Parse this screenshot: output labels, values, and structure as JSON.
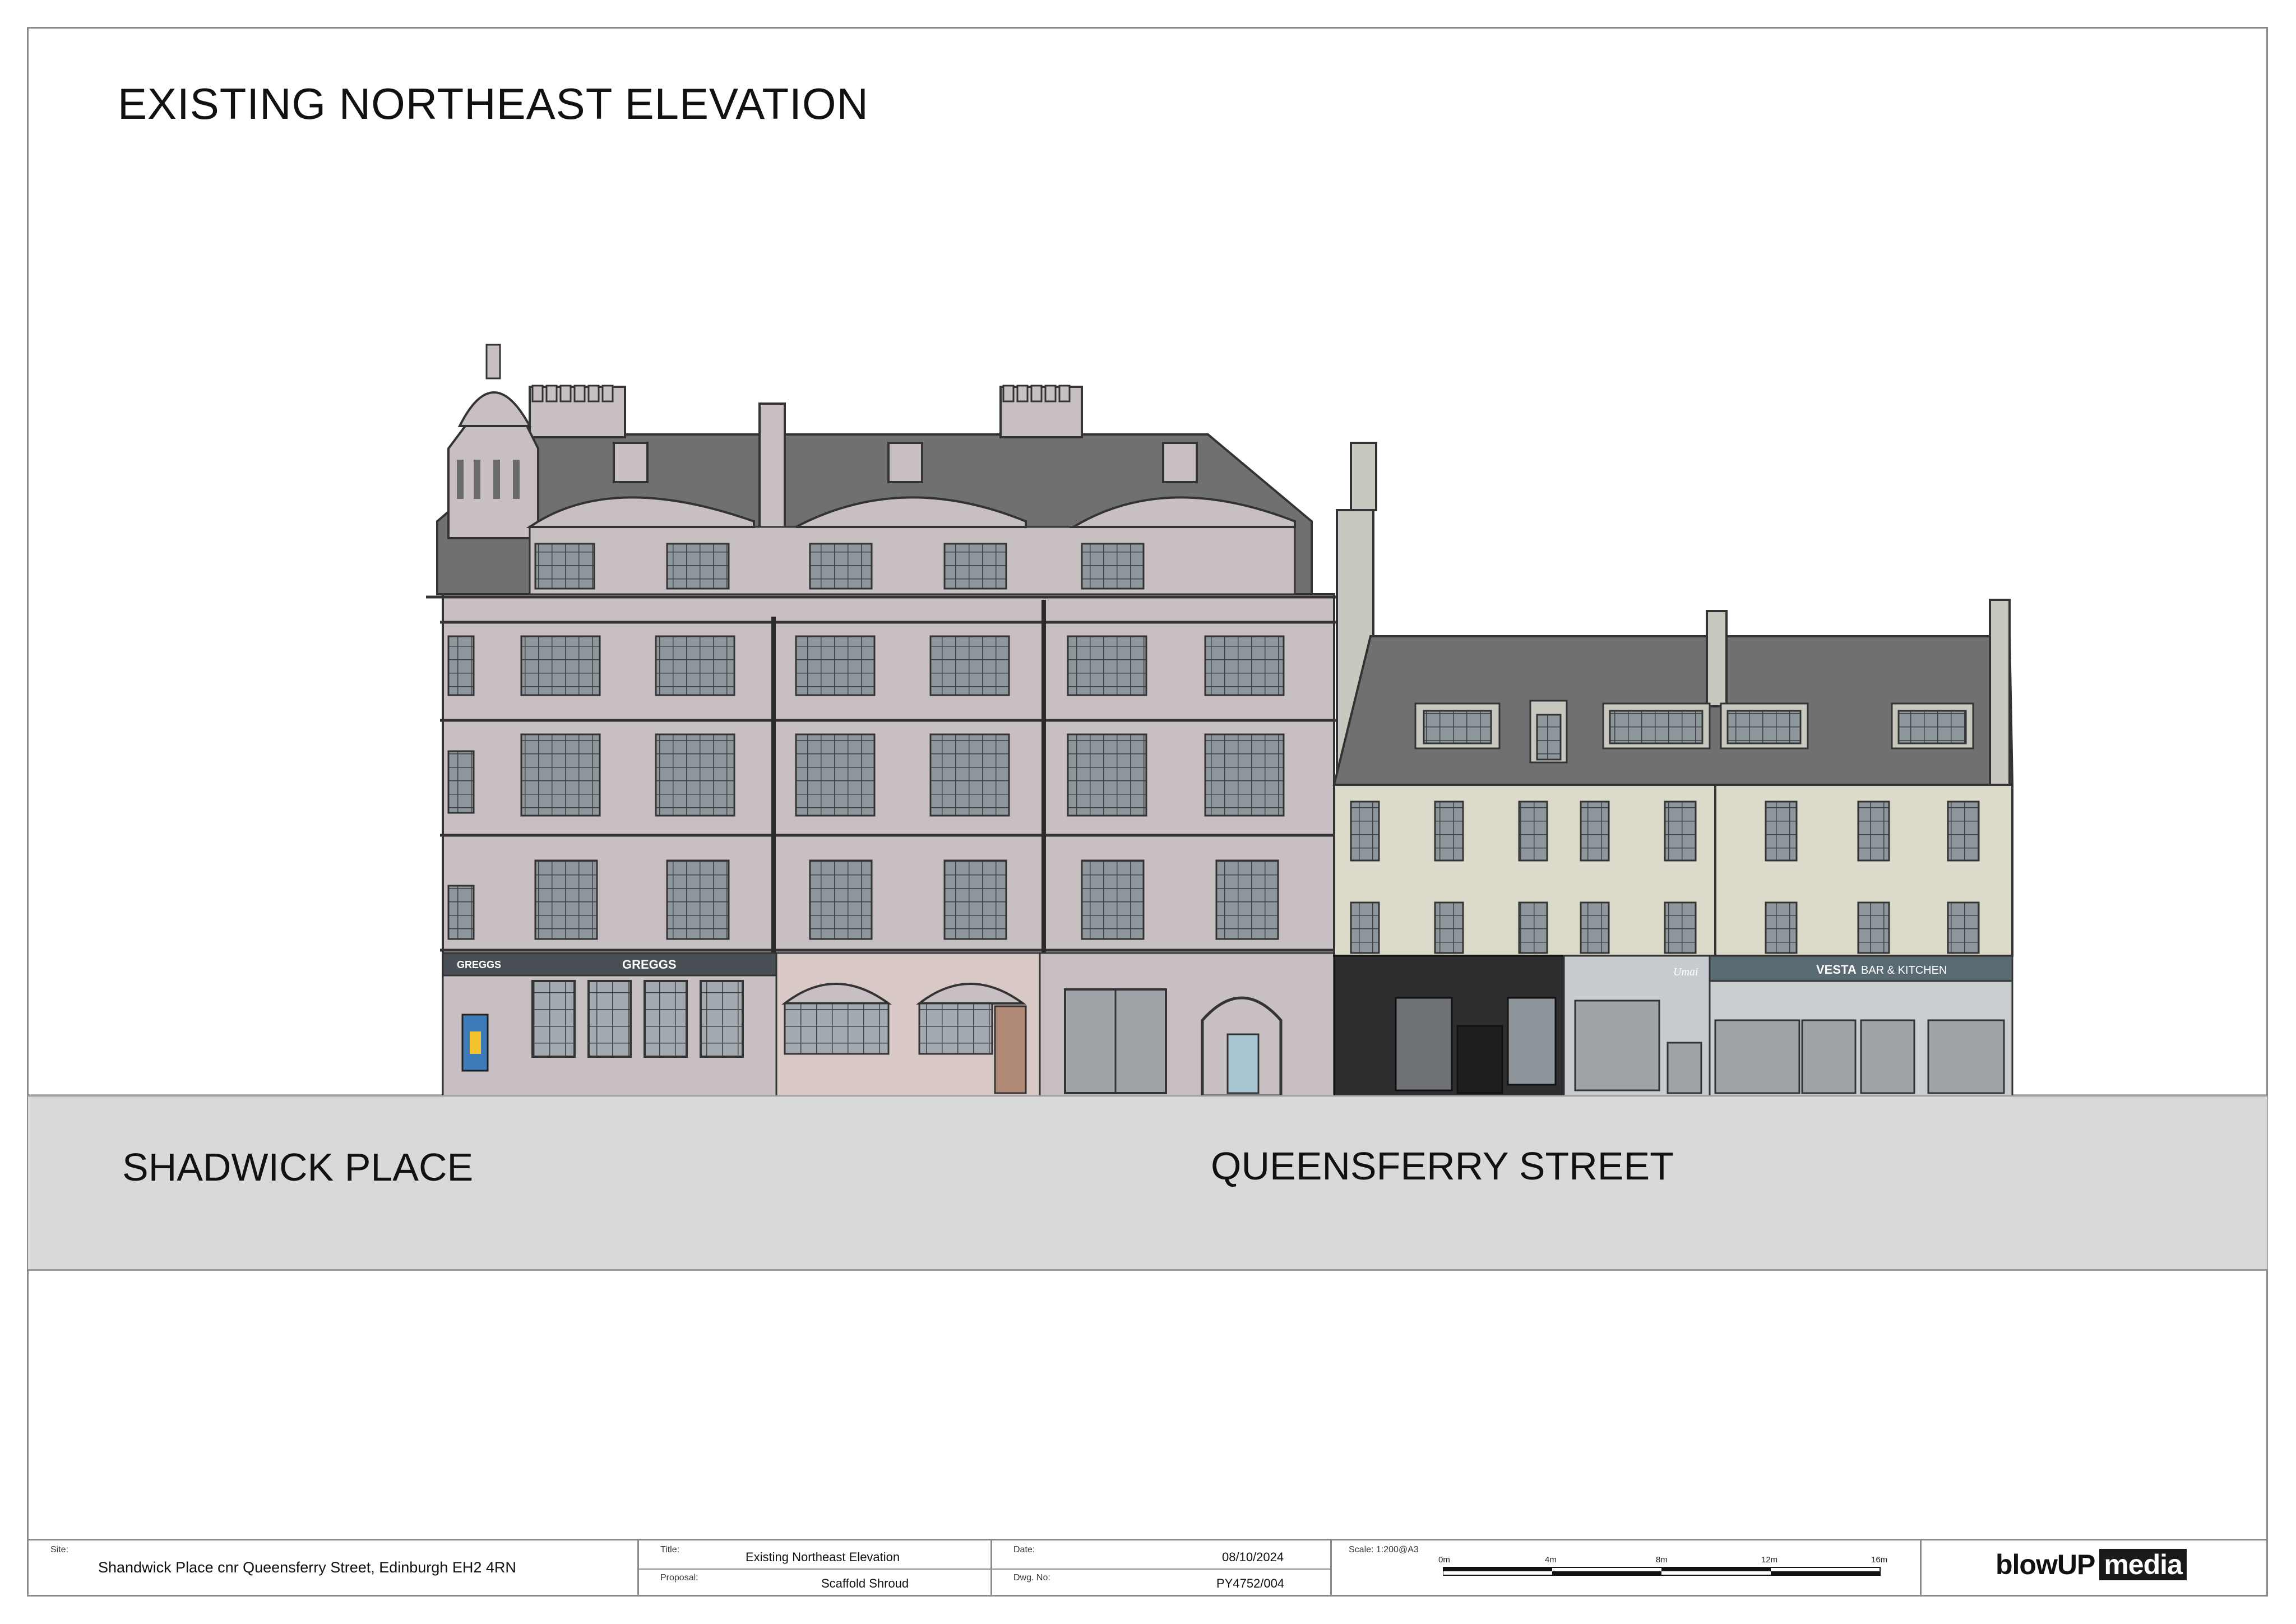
{
  "drawing": {
    "title": "EXISTING NORTHEAST ELEVATION",
    "streets": [
      "SHADWICK PLACE",
      "QUEENSFERRY STREET"
    ],
    "shop_signs": {
      "greggs_small": "GREGGS",
      "greggs_main": "GREGGS",
      "umai": "Umai",
      "vesta_name": "VESTA",
      "vesta_sub": "BAR & KITCHEN"
    },
    "colors": {
      "stone": "#c8bfc2",
      "cream": "#dcdacb",
      "roof": "#6f6f6f",
      "window": "#8e979c",
      "street": "#d9d9d9"
    }
  },
  "title_block": {
    "site_label": "Site:",
    "site_value": "Shandwick Place cnr Queensferry Street, Edinburgh EH2 4RN",
    "title_label": "Title:",
    "title_value": "Existing Northeast Elevation",
    "proposal_label": "Proposal:",
    "proposal_value": "Scaffold Shroud",
    "date_label": "Date:",
    "date_value": "08/10/2024",
    "dwg_label": "Dwg. No:",
    "dwg_value": "PY4752/004",
    "scale_label": "Scale: 1:200@A3",
    "scale_ticks": [
      "0m",
      "4m",
      "8m",
      "12m",
      "16m"
    ],
    "logo_left": "blowUP",
    "logo_right": "media"
  }
}
